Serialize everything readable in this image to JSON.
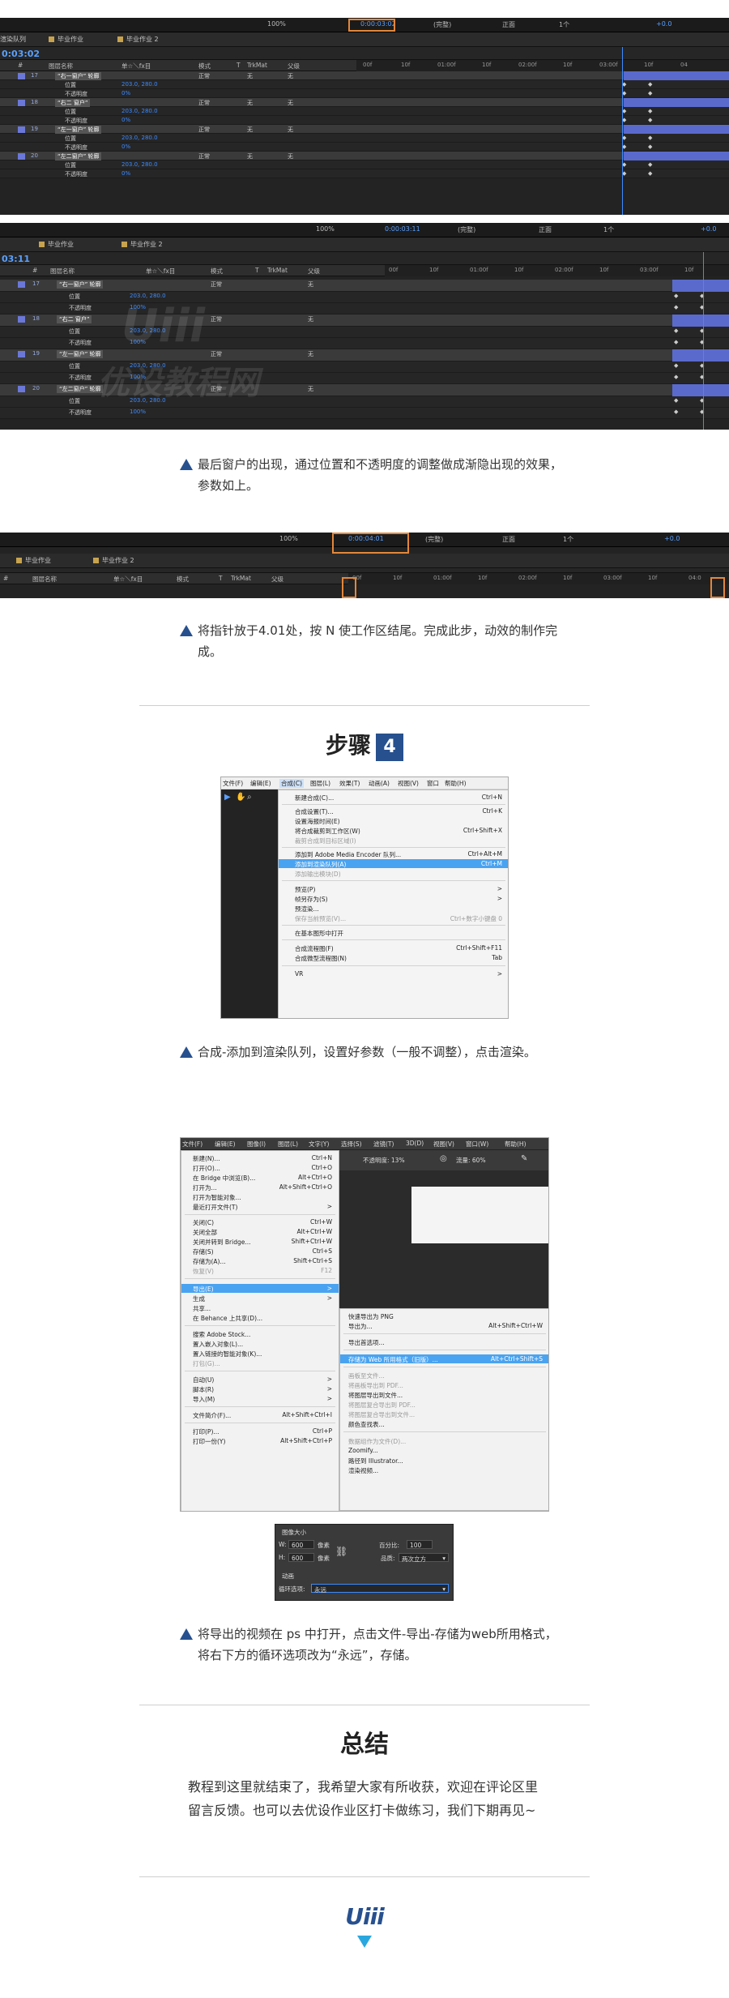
{
  "shot1": {
    "topbar": [
      "100%",
      "0:00:03:02",
      "(完整)",
      "正面",
      "1个",
      "+0.0"
    ],
    "tabs": [
      "渲染队列",
      "毕业作业",
      "毕业作业 2"
    ],
    "timecode": "0:03:02",
    "columns": [
      "#",
      "图层名称",
      "单☆＼fx目",
      "模式",
      "T",
      "TrkMat",
      "父级"
    ],
    "ruler_ticks": [
      "00f",
      "10f",
      "01:00f",
      "10f",
      "02:00f",
      "10f",
      "03:00f",
      "10f",
      "04"
    ],
    "layers": [
      {
        "num": "17",
        "name": "“右一窗户” 轮廓",
        "mode": "正常",
        "trkmat": "无",
        "parent": "无"
      },
      {
        "num": "18",
        "name": "“右二 窗户”",
        "mode": "正常",
        "trkmat": "无",
        "parent": "无"
      },
      {
        "num": "19",
        "name": "“左一窗户” 轮廓",
        "mode": "正常",
        "trkmat": "无",
        "parent": "无"
      },
      {
        "num": "20",
        "name": "“左二窗户” 轮廓",
        "mode": "正常",
        "trkmat": "无",
        "parent": "无"
      }
    ],
    "props": [
      {
        "label": "位置",
        "value": "203.0, 280.0"
      },
      {
        "label": "不透明度",
        "value": "0%"
      },
      {
        "label": "位置",
        "value": "203.0, 280.0"
      },
      {
        "label": "不透明度",
        "value": "0%"
      },
      {
        "label": "位置",
        "value": "203.0, 280.0"
      },
      {
        "label": "不透明度",
        "value": "0%"
      },
      {
        "label": "位置",
        "value": "203.0, 280.0"
      },
      {
        "label": "不透明度",
        "value": "0%"
      }
    ]
  },
  "shot2": {
    "topbar": [
      "100%",
      "0:00:03:11",
      "(完整)",
      "正面",
      "1个",
      "+0.0"
    ],
    "tabs": [
      "毕业作业",
      "毕业作业 2"
    ],
    "timecode": "03:11",
    "columns": [
      "#",
      "图层名称",
      "单☆＼fx目",
      "模式",
      "T",
      "TrkMat",
      "父级"
    ],
    "ruler_ticks": [
      "00f",
      "10f",
      "01:00f",
      "10f",
      "02:00f",
      "10f",
      "03:00f",
      "10f"
    ],
    "layers": [
      {
        "num": "17",
        "name": "“右一窗户” 轮廓",
        "mode": "正常",
        "parent": "无"
      },
      {
        "num": "18",
        "name": "“右二 窗户”",
        "mode": "正常",
        "parent": "无"
      },
      {
        "num": "19",
        "name": "“左一窗户” 轮廓",
        "mode": "正常",
        "parent": "无"
      },
      {
        "num": "20",
        "name": "“左二窗户” 轮廓",
        "mode": "正常",
        "parent": "无"
      }
    ],
    "props": [
      {
        "label": "位置",
        "value": "203.0, 280.0"
      },
      {
        "label": "不透明度",
        "value": "100%"
      },
      {
        "label": "位置",
        "value": "203.0, 280.0"
      },
      {
        "label": "不透明度",
        "value": "100%"
      },
      {
        "label": "位置",
        "value": "203.0, 280.0"
      },
      {
        "label": "不透明度",
        "value": "100%"
      },
      {
        "label": "位置",
        "value": "203.0, 280.0"
      },
      {
        "label": "不透明度",
        "value": "100%"
      }
    ],
    "watermark_1": "Uiii",
    "watermark_2": "优设教程网"
  },
  "caption1": "最后窗户的出现，通过位置和不透明度的调整做成渐隐出现的效果，参数如上。",
  "shot3": {
    "topbar": [
      "100%",
      "0:00:04:01",
      "(完整)",
      "正面",
      "1个",
      "+0.0"
    ],
    "tabs": [
      "毕业作业",
      "毕业作业 2"
    ],
    "columns": [
      "#",
      "图层名称",
      "单☆＼fx目",
      "模式",
      "T",
      "TrkMat",
      "父级"
    ],
    "ruler_ticks": [
      "00f",
      "10f",
      "01:00f",
      "10f",
      "02:00f",
      "10f",
      "03:00f",
      "10f",
      "04:0"
    ]
  },
  "caption2": "将指针放于4.01处，按 N 使工作区结尾。完成此步，动效的制作完成。",
  "step": {
    "label": "步骤",
    "number": "4"
  },
  "ae_menu": {
    "bar": [
      "文件(F)",
      "编辑(E)",
      "合成(C)",
      "图层(L)",
      "效果(T)",
      "动画(A)",
      "视图(V)",
      "窗口",
      "帮助(H)"
    ],
    "items": [
      {
        "label": "新建合成(C)...",
        "shortcut": "Ctrl+N"
      },
      {
        "label": "合成设置(T)...",
        "shortcut": "Ctrl+K"
      },
      {
        "label": "设置海报时间(E)",
        "shortcut": ""
      },
      {
        "label": "将合成裁剪到工作区(W)",
        "shortcut": "Ctrl+Shift+X"
      },
      {
        "label": "裁剪合成到目标区域(I)",
        "shortcut": ""
      },
      {
        "label": "添加到 Adobe Media Encoder 队列...",
        "shortcut": "Ctrl+Alt+M"
      },
      {
        "label": "添加到渲染队列(A)",
        "shortcut": "Ctrl+M"
      },
      {
        "label": "添加输出模块(D)",
        "shortcut": ""
      },
      {
        "label": "预览(P)",
        "shortcut": ">"
      },
      {
        "label": "帧另存为(S)",
        "shortcut": ">"
      },
      {
        "label": "预渲染...",
        "shortcut": ""
      },
      {
        "label": "保存当前预览(V)...",
        "shortcut": "Ctrl+数字小键盘 0"
      },
      {
        "label": "在基本图形中打开",
        "shortcut": ""
      },
      {
        "label": "合成流程图(F)",
        "shortcut": "Ctrl+Shift+F11"
      },
      {
        "label": "合成微型流程图(N)",
        "shortcut": "Tab"
      },
      {
        "label": "VR",
        "shortcut": ">"
      }
    ]
  },
  "caption3": "合成-添加到渲染队列，设置好参数（一般不调整），点击渲染。",
  "ps_menu": {
    "bar": [
      "文件(F)",
      "编辑(E)",
      "图像(I)",
      "图层(L)",
      "文字(Y)",
      "选择(S)",
      "滤镜(T)",
      "3D(D)",
      "视图(V)",
      "窗口(W)",
      "帮助(H)"
    ],
    "optbar": [
      "不透明度: 13%",
      "流量: 60%"
    ],
    "items": [
      {
        "label": "新建(N)...",
        "shortcut": "Ctrl+N"
      },
      {
        "label": "打开(O)...",
        "shortcut": "Ctrl+O"
      },
      {
        "label": "在 Bridge 中浏览(B)...",
        "shortcut": "Alt+Ctrl+O"
      },
      {
        "label": "打开为...",
        "shortcut": "Alt+Shift+Ctrl+O"
      },
      {
        "label": "打开为智能对象...",
        "shortcut": ""
      },
      {
        "label": "最近打开文件(T)",
        "shortcut": ">"
      },
      {
        "label": "关闭(C)",
        "shortcut": "Ctrl+W"
      },
      {
        "label": "关闭全部",
        "shortcut": "Alt+Ctrl+W"
      },
      {
        "label": "关闭并转到 Bridge...",
        "shortcut": "Shift+Ctrl+W"
      },
      {
        "label": "存储(S)",
        "shortcut": "Ctrl+S"
      },
      {
        "label": "存储为(A)...",
        "shortcut": "Shift+Ctrl+S"
      },
      {
        "label": "恢复(V)",
        "shortcut": "F12"
      },
      {
        "label": "导出(E)",
        "shortcut": ">"
      },
      {
        "label": "生成",
        "shortcut": ">"
      },
      {
        "label": "共享...",
        "shortcut": ""
      },
      {
        "label": "在 Behance 上共享(D)...",
        "shortcut": ""
      },
      {
        "label": "搜索 Adobe Stock...",
        "shortcut": ""
      },
      {
        "label": "置入嵌入对象(L)...",
        "shortcut": ""
      },
      {
        "label": "置入链接的智能对象(K)...",
        "shortcut": ""
      },
      {
        "label": "打包(G)...",
        "shortcut": ""
      },
      {
        "label": "自动(U)",
        "shortcut": ">"
      },
      {
        "label": "脚本(R)",
        "shortcut": ">"
      },
      {
        "label": "导入(M)",
        "shortcut": ">"
      },
      {
        "label": "文件简介(F)...",
        "shortcut": "Alt+Shift+Ctrl+I"
      },
      {
        "label": "打印(P)...",
        "shortcut": "Ctrl+P"
      },
      {
        "label": "打印一份(Y)",
        "shortcut": "Alt+Shift+Ctrl+P"
      }
    ],
    "submenu": [
      {
        "label": "快速导出为 PNG",
        "shortcut": ""
      },
      {
        "label": "导出为...",
        "shortcut": "Alt+Shift+Ctrl+W"
      },
      {
        "label": "导出首选项...",
        "shortcut": ""
      },
      {
        "label": "存储为 Web 所用格式（旧版）...",
        "shortcut": "Alt+Ctrl+Shift+S"
      },
      {
        "label": "画板至文件...",
        "shortcut": ""
      },
      {
        "label": "将画板导出到 PDF...",
        "shortcut": ""
      },
      {
        "label": "将图层导出到文件...",
        "shortcut": ""
      },
      {
        "label": "将图层复合导出到 PDF...",
        "shortcut": ""
      },
      {
        "label": "将图层复合导出到文件...",
        "shortcut": ""
      },
      {
        "label": "颜色查找表...",
        "shortcut": ""
      },
      {
        "label": "数据组作为文件(D)...",
        "shortcut": ""
      },
      {
        "label": "Zoomify...",
        "shortcut": ""
      },
      {
        "label": "路径到 Illustrator...",
        "shortcut": ""
      },
      {
        "label": "渲染视频...",
        "shortcut": ""
      }
    ]
  },
  "ps_dialog": {
    "title": "图像大小",
    "w_label": "W:",
    "w_value": "600",
    "unit": "像素",
    "h_label": "H:",
    "h_value": "600",
    "pct_label": "百分比:",
    "pct_value": "100",
    "quality_label": "品质:",
    "quality_value": "两次立方",
    "anim_label": "动画",
    "loop_label": "循环选项:",
    "loop_value": "永远"
  },
  "caption4": "将导出的视频在 ps 中打开，点击文件-导出-存储为web所用格式，将右下方的循环选项改为“永远”，存储。",
  "summary": {
    "title": "总结",
    "text": "教程到这里就结束了，我希望大家有所收获，欢迎在评论区里留言反馈。也可以去优设作业区打卡做练习，我们下期再见~"
  },
  "footer": {
    "logo": "Uiii"
  },
  "colors": {
    "accent": "#27508e",
    "arrow": "#2aa7de",
    "highlight": "#e3873c",
    "ae_blue": "#3d8bff",
    "ae_bar": "#5a6acc"
  }
}
